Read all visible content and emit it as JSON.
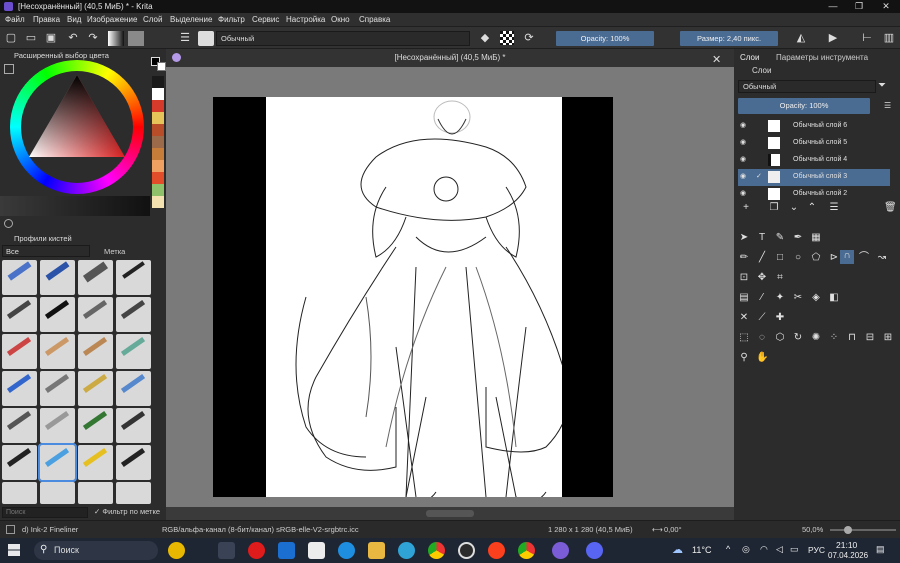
{
  "window": {
    "title": "[Несохранённый] (40,5 МиБ) * - Krita"
  },
  "menu": [
    "Файл",
    "Правка",
    "Вид",
    "Изображение",
    "Слой",
    "Выделение",
    "Фильтр",
    "Сервис",
    "Настройка",
    "Окно",
    "Справка"
  ],
  "toolbar": {
    "preset_name": "Обычный",
    "opacity": "Opacity: 100%",
    "size": "Размер: 2,40 пикс."
  },
  "left": {
    "color_panel_title": "Расширенный выбор цвета",
    "brush_panel_title": "Профили кистей",
    "filter_all": "Все",
    "tag_label": "Метка",
    "search_placeholder": "Поиск",
    "filter_by_tag": "Фильтр по метке",
    "swatches": [
      "#1a1a1a",
      "#ffffff",
      "#d63a2b",
      "#e6c45a",
      "#b84d2a",
      "#9b6a4a",
      "#6ea0c8",
      "#c77d3a",
      "#f0a060",
      "#e44d2a",
      "#8fc06a",
      "#f4e3b0"
    ]
  },
  "document": {
    "tab_title": "[Несохранённый] (40,5 МиБ) *"
  },
  "right": {
    "tabs": [
      "Слои",
      "Параметры инструмента"
    ],
    "panel_title": "Слои",
    "blend_mode": "Обычный",
    "opacity": "Opacity: 100%",
    "layers": [
      {
        "name": "Обычный слой 6",
        "selected": false
      },
      {
        "name": "Обычный слой 5",
        "selected": false
      },
      {
        "name": "Обычный слой 4",
        "selected": false
      },
      {
        "name": "Обычный слой 3",
        "selected": true
      },
      {
        "name": "Обычный слой 2",
        "selected": false
      }
    ]
  },
  "status": {
    "brush": "d) Ink-2 Fineliner",
    "color_space": "RGB/альфа-канал (8-бит/канал)  sRGB-elle-V2-srgbtrc.icc",
    "image_size": "1 280 x 1 280 (40,5 МиБ)",
    "rotation": "0,00°",
    "zoom": "50,0%"
  },
  "taskbar": {
    "search": "Поиск",
    "weather": "11°C",
    "lang": "РУС",
    "time": "21:10",
    "date": "07.04.2026"
  }
}
